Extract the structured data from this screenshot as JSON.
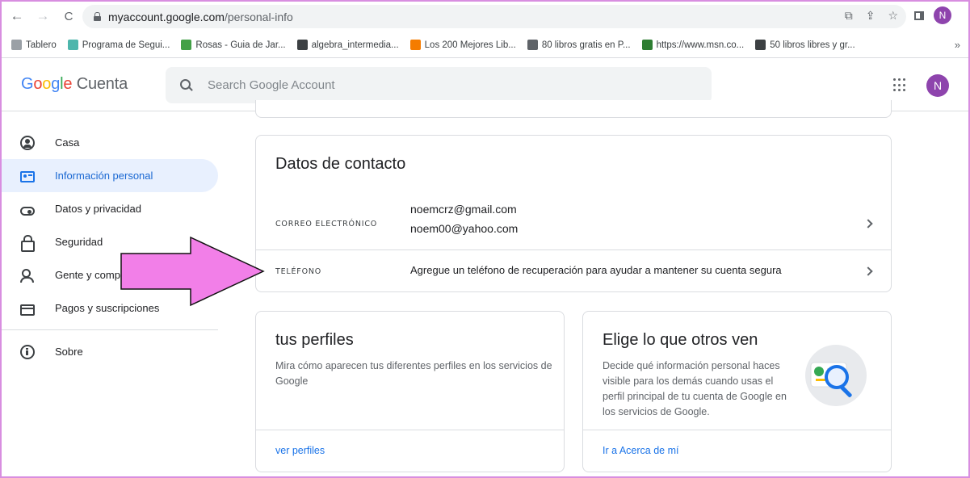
{
  "browser": {
    "url_host": "myaccount.google.com",
    "url_path": "/personal-info",
    "avatar_letter": "N",
    "nav": {
      "back": "←",
      "forward": "→",
      "reload": "C"
    },
    "bookmarks": [
      {
        "label": "Tablero",
        "color": "#9aa0a6"
      },
      {
        "label": "Programa de Segui...",
        "color": "#4db6ac"
      },
      {
        "label": "Rosas - Guia de Jar...",
        "color": "#43a047"
      },
      {
        "label": "algebra_intermedia...",
        "color": "#3c4043"
      },
      {
        "label": "Los 200 Mejores Lib...",
        "color": "#f57c00"
      },
      {
        "label": "80 libros gratis en P...",
        "color": "#5f6368"
      },
      {
        "label": "https://www.msn.co...",
        "color": "#2e7d32"
      },
      {
        "label": "50 libros libres y gr...",
        "color": "#3c4043"
      }
    ],
    "bookmarks_more": "»"
  },
  "header": {
    "logo_word": "Google",
    "logo_suffix": "Cuenta",
    "search_placeholder": "Search Google Account",
    "avatar_letter": "N"
  },
  "sidebar": {
    "items": [
      {
        "label": "Casa",
        "icon": "home-icon"
      },
      {
        "label": "Información personal",
        "icon": "id-card-icon",
        "active": true
      },
      {
        "label": "Datos y privacidad",
        "icon": "toggle-icon"
      },
      {
        "label": "Seguridad",
        "icon": "lock-icon"
      },
      {
        "label": "Gente y compartir",
        "icon": "people-icon"
      },
      {
        "label": "Pagos y suscripciones",
        "icon": "payment-card-icon"
      },
      {
        "label": "Sobre",
        "icon": "info-icon"
      }
    ]
  },
  "contact": {
    "title": "Datos de contacto",
    "email_label": "CORREO ELECTRÓNICO",
    "emails": [
      "noemcrz@gmail.com",
      "noem00@yahoo.com"
    ],
    "phone_label": "TELÉFONO",
    "phone_value": "Agregue un teléfono de recuperación para ayudar a mantener su cuenta segura"
  },
  "profiles_card": {
    "title": "tus perfiles",
    "description": "Mira cómo aparecen tus diferentes perfiles en los servicios de Google",
    "link": "ver perfiles"
  },
  "others_card": {
    "title": "Elige lo que otros ven",
    "description": "Decide qué información personal haces visible para los demás cuando usas el perfil principal de tu cuenta de Google en los servicios de Google.",
    "link": "Ir a Acerca de mí"
  },
  "colors": {
    "accent": "#1a73e8",
    "active_bg": "#e8f0fe",
    "avatar": "#8e44ad",
    "annotation_arrow": "#f27fe8"
  }
}
